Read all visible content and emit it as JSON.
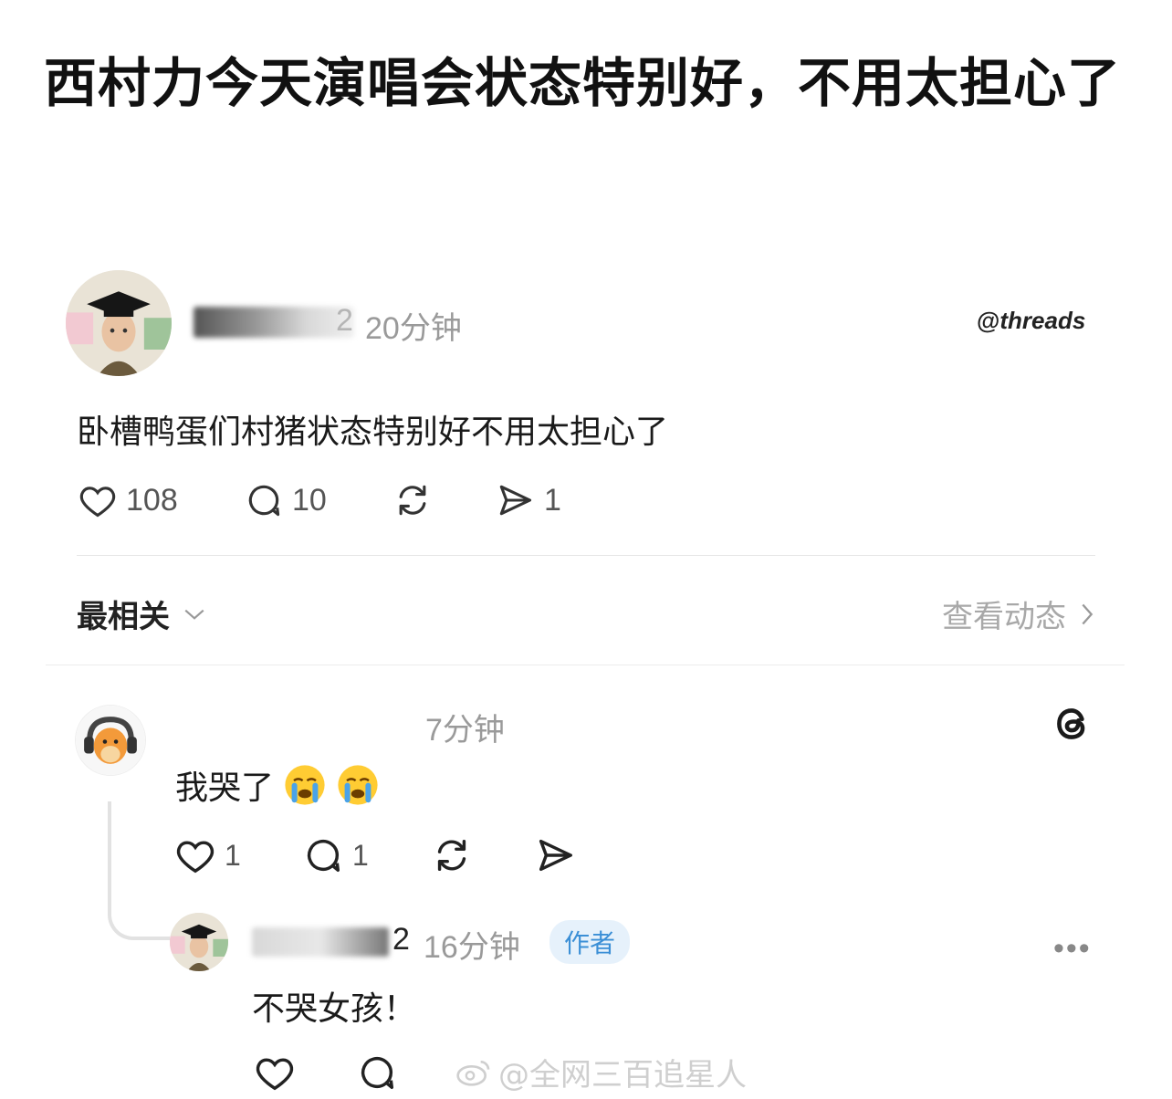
{
  "headline": "西村力今天演唱会状态特别好，不用太担心了",
  "post": {
    "username_tail": "2",
    "time": "20分钟",
    "brand": "threads",
    "text": "卧槽鸭蛋们村猪状态特别好不用太担心了",
    "actions": {
      "likes": "108",
      "comments": "10",
      "shares": "1"
    }
  },
  "sort": {
    "label": "最相关",
    "view_activity": "查看动态"
  },
  "reply1": {
    "time": "7分钟",
    "text": "我哭了",
    "actions": {
      "likes": "1",
      "comments": "1"
    }
  },
  "reply2": {
    "username_tail": "2",
    "time": "16分钟",
    "badge": "作者",
    "text": "不哭女孩！",
    "more": "•••"
  },
  "watermark": "@全网三百追星人"
}
